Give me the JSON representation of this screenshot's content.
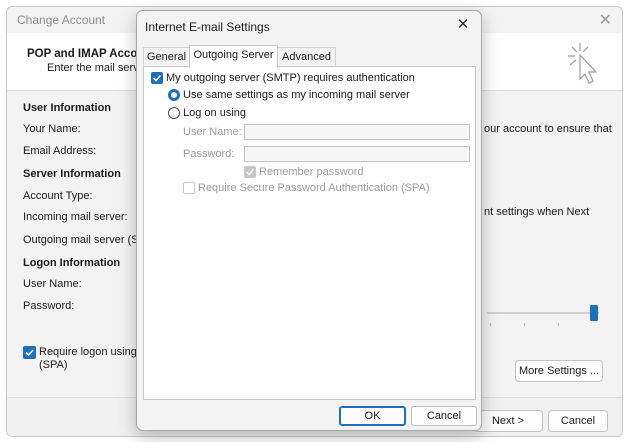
{
  "background_window": {
    "title": "Change Account",
    "header_title": "POP and IMAP Accoun",
    "header_subtitle": "Enter the mail server",
    "section_user_info": "User Information",
    "label_your_name": "Your Name:",
    "label_email": "Email Address:",
    "section_server_info": "Server Information",
    "label_account_type": "Account Type:",
    "label_incoming": "Incoming mail server:",
    "label_outgoing": "Outgoing mail server (SM",
    "section_logon_info": "Logon Information",
    "label_user_name": "User Name:",
    "label_password": "Password:",
    "right_text_1": "our account to ensure that",
    "right_text_2": "nt settings when Next",
    "checkbox_spa_line1": "Require logon using",
    "checkbox_spa_line2": "(SPA)",
    "more_settings_button": "More Settings ...",
    "next_button": "Next >",
    "cancel_button": "Cancel"
  },
  "dialog": {
    "title": "Internet E-mail Settings",
    "tabs": [
      {
        "label": "General",
        "active": false
      },
      {
        "label": "Outgoing Server",
        "active": true
      },
      {
        "label": "Advanced",
        "active": false
      }
    ],
    "outgoing": {
      "smtp_auth_label": "My outgoing server (SMTP) requires authentication",
      "smtp_auth_checked": true,
      "use_same_label": "Use same settings as my incoming mail server",
      "use_same_selected": true,
      "logon_using_label": "Log on using",
      "user_name_label": "User Name:",
      "user_name_value": "",
      "password_label": "Password:",
      "password_value": "",
      "remember_password_label": "Remember password",
      "remember_password_checked": true,
      "spa_label": "Require Secure Password Authentication (SPA)",
      "spa_checked": false
    },
    "ok_button": "OK",
    "cancel_button": "Cancel"
  },
  "colors": {
    "accent": "#1f6fbf",
    "disabled_text": "#9b9b9b"
  }
}
